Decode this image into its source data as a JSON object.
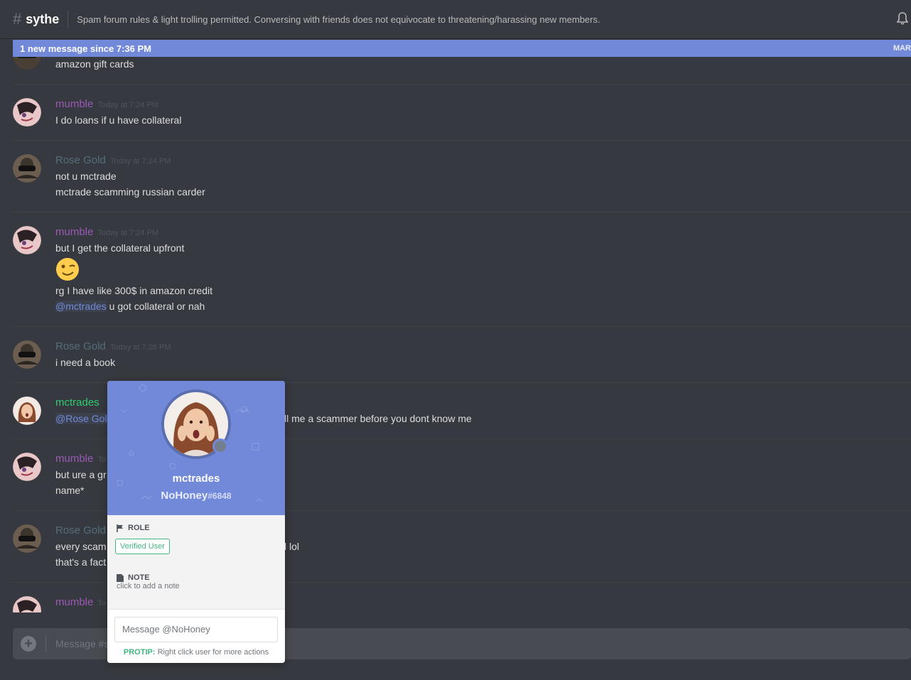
{
  "channel": {
    "hash": "#",
    "name": "sythe",
    "topic": "Spam forum rules & light trolling permitted. Conversing with friends does not equivocate to threatening/harassing new members."
  },
  "new_bar": {
    "text": "1 new message since 7:36 PM",
    "mark": "MAR"
  },
  "messages": [
    {
      "user": "",
      "time": "",
      "lines": [
        "amazon gift cards"
      ]
    },
    {
      "user": "mumble",
      "time": "Today at 7:24 PM",
      "lines": [
        "I do loans if u have collateral"
      ]
    },
    {
      "user": "Rose Gold",
      "time": "Today at 7:24 PM",
      "lines": [
        "not u mctrade",
        "mctrade scamming russian carder"
      ]
    },
    {
      "user": "mumble",
      "time": "Today at 7:24 PM",
      "lines": [
        "but I get the collateral upfront",
        "rg I have like 300$ in amazon credit"
      ],
      "mention": "@mctrades",
      "mention_rest": " u got collateral or nah"
    },
    {
      "user": "Rose Gold",
      "time": "Today at 7:26 PM",
      "lines": [
        "i need a book"
      ]
    },
    {
      "user": "mctrades",
      "mention": "@Rose Golc",
      "rest": "ll me a scammer before  you dont know me"
    },
    {
      "user": "mumble",
      "time_partial": "To",
      "lines": [
        "but ure a gr",
        "name*"
      ]
    },
    {
      "user": "Rose Gold",
      "lines": [
        "every scam",
        "that's a fact"
      ],
      "rest": "l lol"
    },
    {
      "user": "mumble",
      "time_partial": "To"
    }
  ],
  "composer": {
    "placeholder": "Message #sy"
  },
  "popout": {
    "username": "mctrades",
    "nickname": "NoHoney",
    "discriminator": "#6848",
    "role_title": "ROLE",
    "role": "Verified User",
    "note_title": "NOTE",
    "note_placeholder": "click to add a note",
    "dm_placeholder": "Message @NoHoney",
    "protip_label": "PROTIP:",
    "protip_text": " Right click user for more actions"
  },
  "colors": {
    "accent": "#7289da",
    "mumble": "#9b59b6",
    "rose": "#546e7a",
    "mctrades": "#2ecc71",
    "verified": "#43b581"
  }
}
